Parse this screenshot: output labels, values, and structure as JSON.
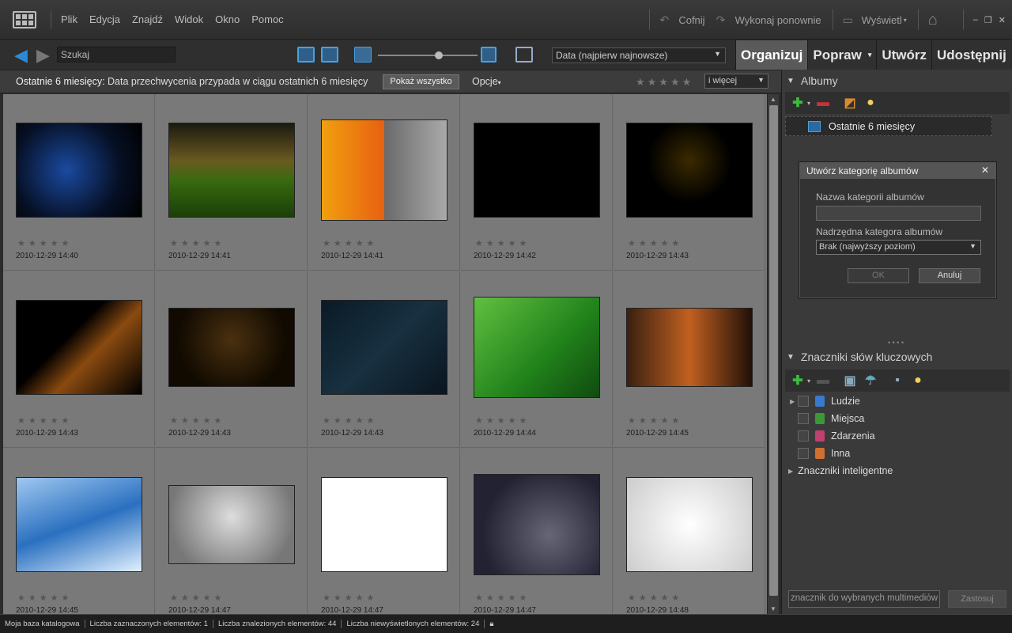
{
  "menu": {
    "items": [
      "Plik",
      "Edycja",
      "Znajdź",
      "Widok",
      "Okno",
      "Pomoc"
    ],
    "undo": "Cofnij",
    "redo": "Wykonaj ponownie",
    "display": "Wyświetl"
  },
  "toolbar": {
    "search_value": "Szukaj",
    "sort": "Data (najpierw najnowsze)"
  },
  "tabs": [
    "Organizuj",
    "Popraw",
    "Utwórz",
    "Udostępnij"
  ],
  "filter": {
    "label": "Ostatnie 6 miesięcy:",
    "text": "Data przechwycenia przypada w ciągu ostatnich 6 miesięcy",
    "show_all": "Pokaż wszystko",
    "options": "Opcje",
    "more": "i więcej"
  },
  "photos": [
    {
      "date": "2010-12-29 14:40"
    },
    {
      "date": "2010-12-29 14:41"
    },
    {
      "date": "2010-12-29 14:41"
    },
    {
      "date": "2010-12-29 14:42"
    },
    {
      "date": "2010-12-29 14:43"
    },
    {
      "date": "2010-12-29 14:43"
    },
    {
      "date": "2010-12-29 14:43"
    },
    {
      "date": "2010-12-29 14:43"
    },
    {
      "date": "2010-12-29 14:44"
    },
    {
      "date": "2010-12-29 14:45"
    },
    {
      "date": "2010-12-29 14:45"
    },
    {
      "date": "2010-12-29 14:47"
    },
    {
      "date": "2010-12-29 14:47"
    },
    {
      "date": "2010-12-29 14:47"
    },
    {
      "date": "2010-12-29 14:48"
    }
  ],
  "albums": {
    "title": "Albumy",
    "item": "Ostatnie 6 miesięcy"
  },
  "dialog": {
    "title": "Utwórz kategorię albumów",
    "name_label": "Nazwa kategorii albumów",
    "parent_label": "Nadrzędna kategora albumów",
    "parent_value": "Brak (najwyższy poziom)",
    "ok": "OK",
    "cancel": "Anuluj"
  },
  "keywords": {
    "title": "Znaczniki słów kluczowych",
    "items": [
      "Ludzie",
      "Miejsca",
      "Zdarzenia",
      "Inna"
    ],
    "smart": "Znaczniki inteligentne",
    "apply_placeholder": "znacznik do wybranych multimediów",
    "apply": "Zastosuj"
  },
  "status": [
    "Moja baza katalogowa",
    "Liczba zaznaczonych elementów: 1",
    "Liczba znalezionych elementów: 44",
    "Liczba niewyświetlonych elementów: 24"
  ],
  "colors": {
    "accent": "#2a8ad8",
    "people": "#3a7acc",
    "places": "#3a9a3a",
    "events": "#c04070",
    "other": "#d07030"
  }
}
